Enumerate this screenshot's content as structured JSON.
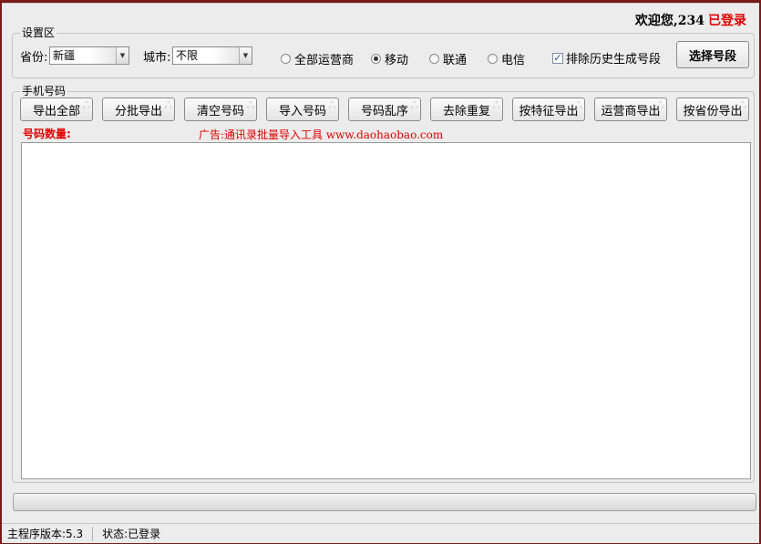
{
  "header": {
    "welcome": "欢迎您,234",
    "login_status": "已登录"
  },
  "settings": {
    "group_label": "设置区",
    "province_label": "省份:",
    "province_value": "新疆",
    "city_label": "城市:",
    "city_value": "不限",
    "radios": [
      {
        "label": "全部运营商",
        "checked": false
      },
      {
        "label": "移动",
        "checked": true
      },
      {
        "label": "联通",
        "checked": false
      },
      {
        "label": "电信",
        "checked": false
      }
    ],
    "exclude_label": "排除历史生成号段",
    "exclude_checked": true,
    "select_button": "选择号段"
  },
  "phones": {
    "group_label": "手机号码",
    "buttons": [
      "导出全部",
      "分批导出",
      "清空号码",
      "导入号码",
      "号码乱序",
      "去除重复",
      "按特征导出",
      "运营商导出",
      "按省份导出"
    ],
    "count_label": "号码数量:",
    "ad_text": "广告:通讯录批量导入工具 www.daohaobao.com",
    "textarea_value": ""
  },
  "statusbar": {
    "version": "主程序版本:5.3",
    "status": "状态:已登录"
  },
  "colors": {
    "accent_red": "#e00000",
    "window_bg": "#ececec"
  }
}
